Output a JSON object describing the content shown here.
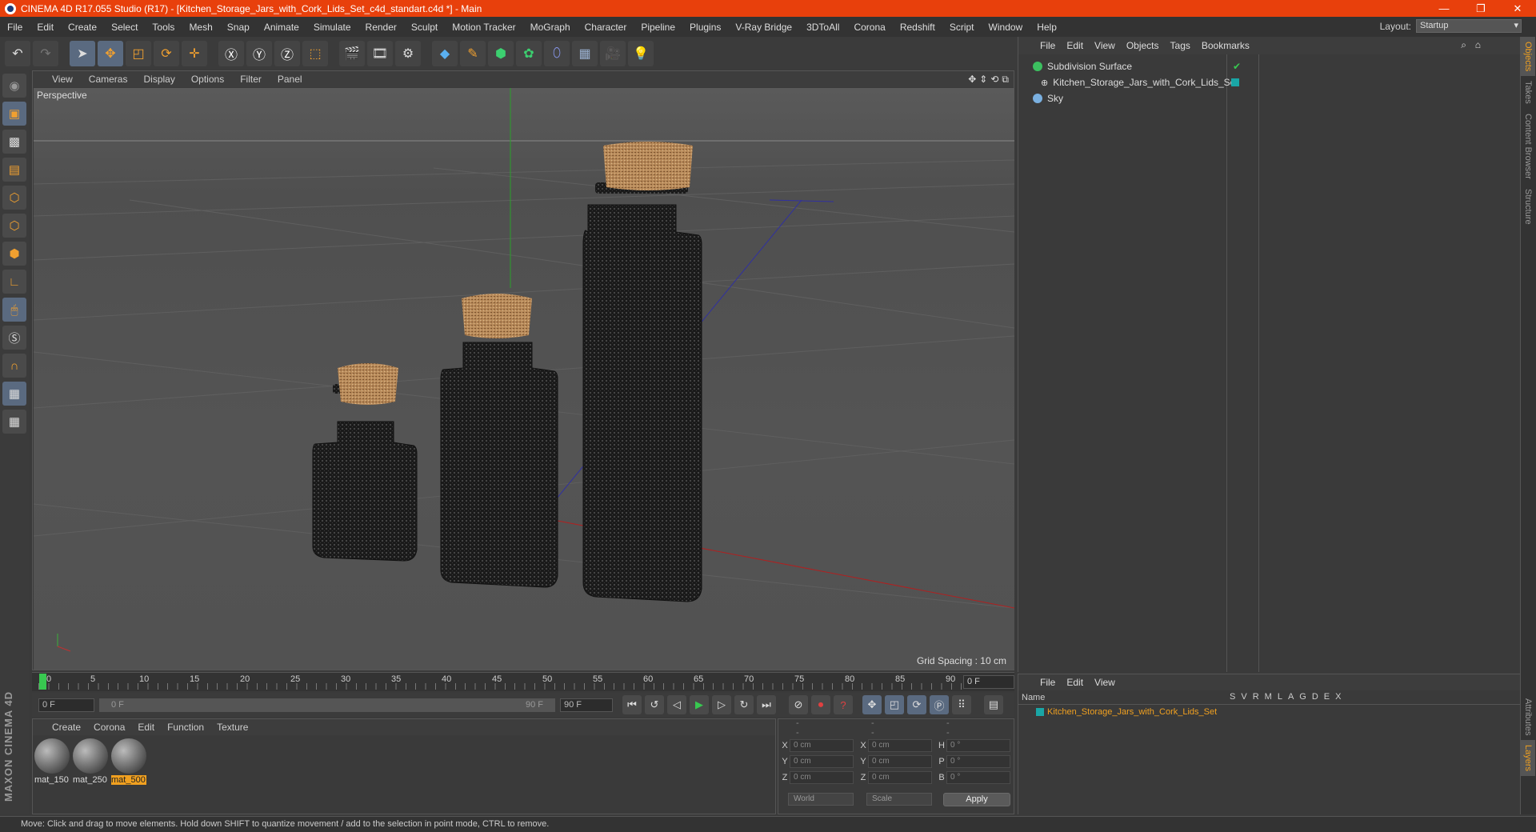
{
  "window": {
    "title": "CINEMA 4D R17.055 Studio (R17) - [Kitchen_Storage_Jars_with_Cork_Lids_Set_c4d_standart.c4d *] - Main"
  },
  "menubar": {
    "items": [
      "File",
      "Edit",
      "Create",
      "Select",
      "Tools",
      "Mesh",
      "Snap",
      "Animate",
      "Simulate",
      "Render",
      "Sculpt",
      "Motion Tracker",
      "MoGraph",
      "Character",
      "Pipeline",
      "Plugins",
      "V-Ray Bridge",
      "3DToAll",
      "Corona",
      "Redshift",
      "Script",
      "Window",
      "Help"
    ],
    "layout_label": "Layout:",
    "layout_value": "Startup"
  },
  "viewport": {
    "menu": [
      "View",
      "Cameras",
      "Display",
      "Options",
      "Filter",
      "Panel"
    ],
    "label": "Perspective",
    "grid_spacing": "Grid Spacing : 10 cm"
  },
  "timeline": {
    "ticks": [
      "0",
      "5",
      "10",
      "15",
      "20",
      "25",
      "30",
      "35",
      "40",
      "45",
      "50",
      "55",
      "60",
      "65",
      "70",
      "75",
      "80",
      "85",
      "90"
    ],
    "current_frame": "0 F"
  },
  "transport": {
    "start_frame": "0 F",
    "range_start": "0 F",
    "range_end": "90 F",
    "end_frame": "90 F"
  },
  "materials": {
    "menu": [
      "Create",
      "Corona",
      "Edit",
      "Function",
      "Texture"
    ],
    "items": [
      "mat_150",
      "mat_250",
      "mat_500"
    ]
  },
  "coords": {
    "headers": [
      "--",
      "--",
      "--"
    ],
    "rows": [
      {
        "a": "X",
        "av": "0 cm",
        "b": "X",
        "bv": "0 cm",
        "c": "H",
        "cv": "0 °"
      },
      {
        "a": "Y",
        "av": "0 cm",
        "b": "Y",
        "bv": "0 cm",
        "c": "P",
        "cv": "0 °"
      },
      {
        "a": "Z",
        "av": "0 cm",
        "b": "Z",
        "bv": "0 cm",
        "c": "B",
        "cv": "0 °"
      }
    ],
    "mode": "World",
    "scale": "Scale",
    "apply": "Apply"
  },
  "objects": {
    "menu": [
      "File",
      "Edit",
      "View",
      "Objects",
      "Tags",
      "Bookmarks"
    ],
    "items": [
      "Subdivision Surface",
      "Kitchen_Storage_Jars_with_Cork_Lids_Set",
      "Sky"
    ]
  },
  "layers": {
    "menu": [
      "File",
      "Edit",
      "View"
    ],
    "name_header": "Name",
    "columns": [
      "S",
      "V",
      "R",
      "M",
      "L",
      "A",
      "G",
      "D",
      "E",
      "X"
    ],
    "items": [
      "Kitchen_Storage_Jars_with_Cork_Lids_Set"
    ]
  },
  "right_tabs": [
    "Objects",
    "Takes",
    "Content Browser",
    "Structure",
    "Attributes",
    "Layers"
  ],
  "brand": "MAXON CINEMA 4D",
  "status": "Move: Click and drag to move elements. Hold down SHIFT to quantize movement / add to the selection in point mode, CTRL to remove.",
  "colors": {
    "titlebar": "#e8400c",
    "accent": "#f0a020",
    "teal": "#1aa6a6"
  }
}
